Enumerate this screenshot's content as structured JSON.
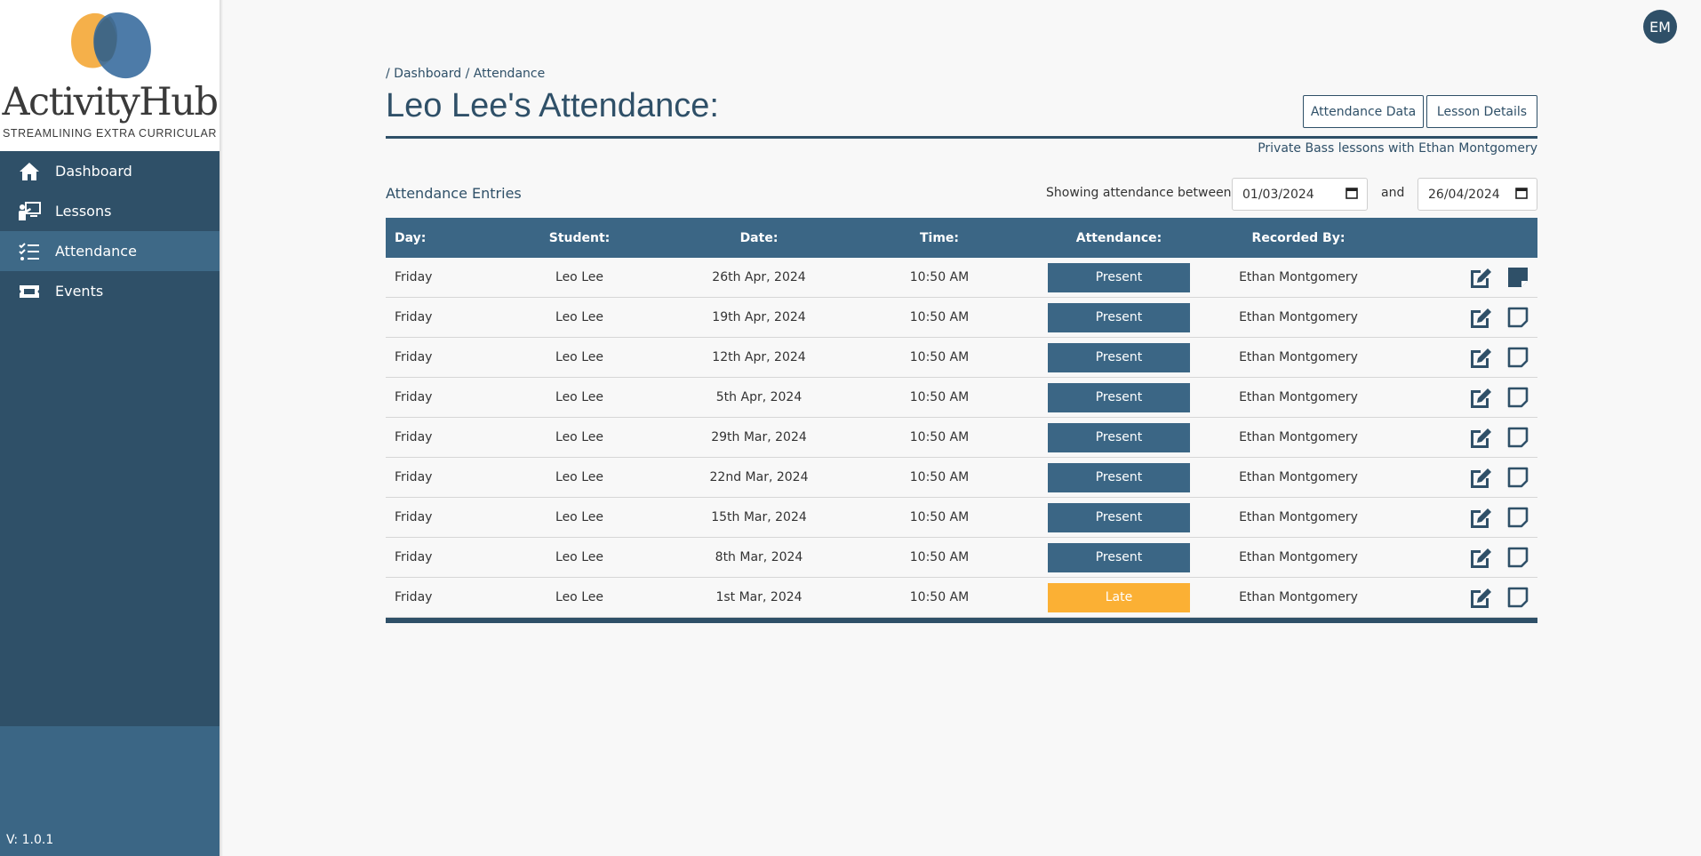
{
  "app": {
    "logo_text": "ActivityHub",
    "tagline": "STREAMLINING EXTRA CURRICULAR",
    "version": "V: 1.0.1"
  },
  "sidebar": {
    "items": [
      {
        "label": "Dashboard",
        "icon": "home-icon",
        "active": false
      },
      {
        "label": "Lessons",
        "icon": "teacher-icon",
        "active": false
      },
      {
        "label": "Attendance",
        "icon": "checklist-icon",
        "active": true
      },
      {
        "label": "Events",
        "icon": "ticket-icon",
        "active": false
      }
    ]
  },
  "user": {
    "initials": "EM"
  },
  "breadcrumb": {
    "sep1": "/",
    "dashboard": "Dashboard",
    "sep2": "/",
    "current": "Attendance"
  },
  "page": {
    "title": "Leo Lee's Attendance:",
    "subtitle": "Private Bass lessons with Ethan Montgomery",
    "buttons": {
      "attendance_data": "Attendance Data",
      "lesson_details": "Lesson Details"
    }
  },
  "filter": {
    "section_title": "Attendance Entries",
    "label": "Showing attendance between",
    "start": "01/03/2024",
    "and_label": "and",
    "end": "26/04/2024"
  },
  "table": {
    "headers": [
      "Day:",
      "Student:",
      "Date:",
      "Time:",
      "Attendance:",
      "Recorded By:"
    ],
    "rows": [
      {
        "day": "Friday",
        "student": "Leo Lee",
        "date": "26th Apr, 2024",
        "time": "10:50 AM",
        "attendance": "Present",
        "recorded_by": "Ethan Montgomery",
        "has_note": true
      },
      {
        "day": "Friday",
        "student": "Leo Lee",
        "date": "19th Apr, 2024",
        "time": "10:50 AM",
        "attendance": "Present",
        "recorded_by": "Ethan Montgomery",
        "has_note": false
      },
      {
        "day": "Friday",
        "student": "Leo Lee",
        "date": "12th Apr, 2024",
        "time": "10:50 AM",
        "attendance": "Present",
        "recorded_by": "Ethan Montgomery",
        "has_note": false
      },
      {
        "day": "Friday",
        "student": "Leo Lee",
        "date": "5th Apr, 2024",
        "time": "10:50 AM",
        "attendance": "Present",
        "recorded_by": "Ethan Montgomery",
        "has_note": false
      },
      {
        "day": "Friday",
        "student": "Leo Lee",
        "date": "29th Mar, 2024",
        "time": "10:50 AM",
        "attendance": "Present",
        "recorded_by": "Ethan Montgomery",
        "has_note": false
      },
      {
        "day": "Friday",
        "student": "Leo Lee",
        "date": "22nd Mar, 2024",
        "time": "10:50 AM",
        "attendance": "Present",
        "recorded_by": "Ethan Montgomery",
        "has_note": false
      },
      {
        "day": "Friday",
        "student": "Leo Lee",
        "date": "15th Mar, 2024",
        "time": "10:50 AM",
        "attendance": "Present",
        "recorded_by": "Ethan Montgomery",
        "has_note": false
      },
      {
        "day": "Friday",
        "student": "Leo Lee",
        "date": "8th Mar, 2024",
        "time": "10:50 AM",
        "attendance": "Present",
        "recorded_by": "Ethan Montgomery",
        "has_note": false
      },
      {
        "day": "Friday",
        "student": "Leo Lee",
        "date": "1st Mar, 2024",
        "time": "10:50 AM",
        "attendance": "Late",
        "recorded_by": "Ethan Montgomery",
        "has_note": false
      }
    ]
  },
  "colors": {
    "primary": "#2f5068",
    "header": "#3b6685",
    "present": "#3b6685",
    "late": "#fbb034",
    "logo_orange": "#f5b04a",
    "logo_blue": "#3a6d9e"
  }
}
